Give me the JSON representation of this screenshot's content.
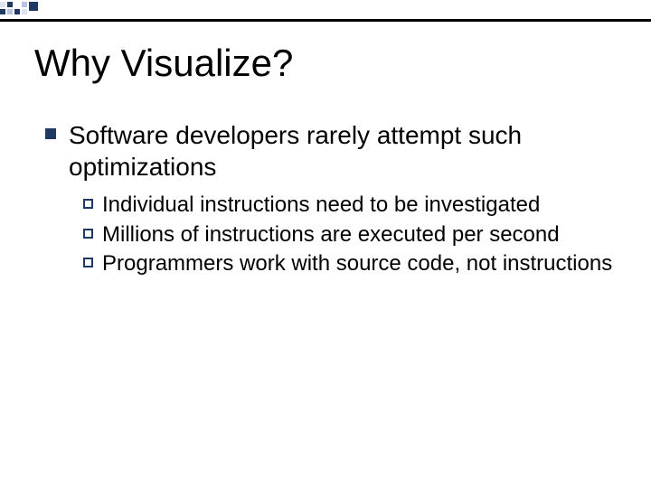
{
  "title": "Why Visualize?",
  "point": "Software developers rarely attempt such optimizations",
  "subs": {
    "a": "Individual instructions need to be investigated",
    "b": "Millions of instructions are executed per second",
    "c": "Programmers work with source code, not instructions"
  }
}
